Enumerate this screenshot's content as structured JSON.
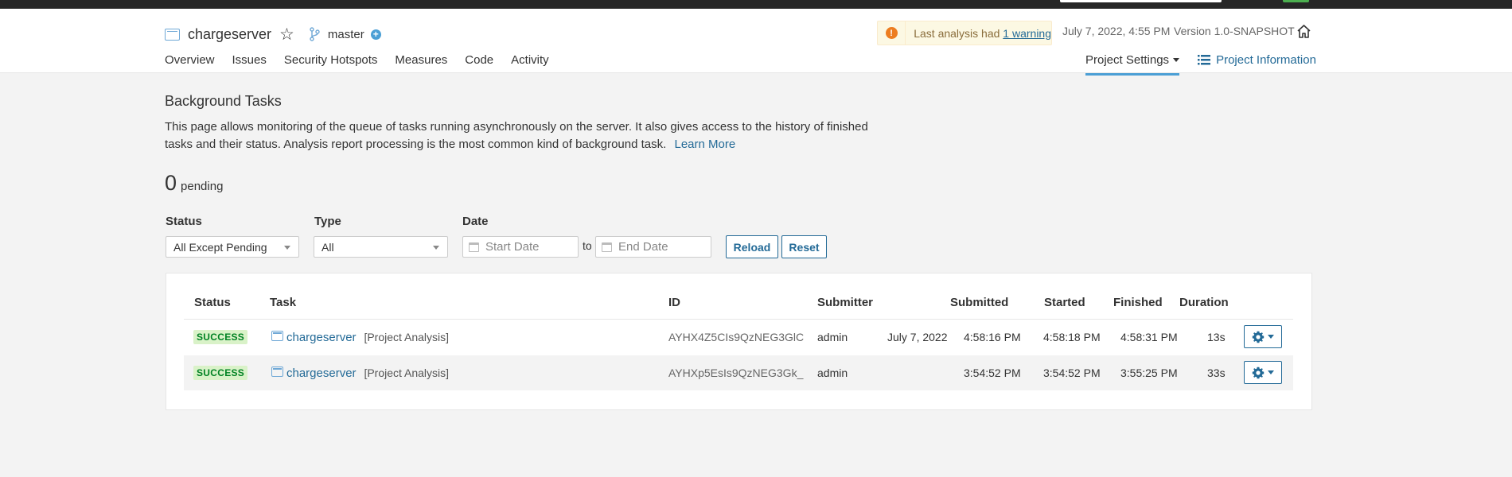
{
  "project": {
    "name": "chargeserver",
    "branch": "master"
  },
  "warning": {
    "prefix": "Last analysis had",
    "link": "1 warning"
  },
  "analysis_date": "July 7, 2022, 4:55 PM",
  "version": "Version 1.0-SNAPSHOT",
  "nav": {
    "items": [
      "Overview",
      "Issues",
      "Security Hotspots",
      "Measures",
      "Code",
      "Activity"
    ],
    "settings": "Project Settings",
    "info": "Project Information"
  },
  "page": {
    "title": "Background Tasks",
    "description": "This page allows monitoring of the queue of tasks running asynchronously on the server. It also gives access to the history of finished tasks and their status. Analysis report processing is the most common kind of background task.",
    "learn_more": "Learn More",
    "pending_count": "0",
    "pending_label": "pending"
  },
  "filters": {
    "status_label": "Status",
    "status_value": "All Except Pending",
    "type_label": "Type",
    "type_value": "All",
    "date_label": "Date",
    "start_placeholder": "Start Date",
    "to_label": "to",
    "end_placeholder": "End Date",
    "reload": "Reload",
    "reset": "Reset"
  },
  "table": {
    "headers": {
      "status": "Status",
      "task": "Task",
      "id": "ID",
      "submitter": "Submitter",
      "submitted": "Submitted",
      "started": "Started",
      "finished": "Finished",
      "duration": "Duration"
    },
    "rows": [
      {
        "status": "SUCCESS",
        "task": "chargeserver",
        "type": "[Project Analysis]",
        "id": "AYHX4Z5CIs9QzNEG3GlC",
        "submitter": "admin",
        "date": "July 7, 2022",
        "submitted": "4:58:16 PM",
        "started": "4:58:18 PM",
        "finished": "4:58:31 PM",
        "duration": "13s"
      },
      {
        "status": "SUCCESS",
        "task": "chargeserver",
        "type": "[Project Analysis]",
        "id": "AYHXp5EsIs9QzNEG3Gk_",
        "submitter": "admin",
        "date": "",
        "submitted": "3:54:52 PM",
        "started": "3:54:52 PM",
        "finished": "3:55:25 PM",
        "duration": "33s"
      }
    ]
  },
  "colors": {
    "accent": "#236a97",
    "success_bg": "#d9f2c8",
    "success_text": "#008223",
    "warning_bg": "#fcf8e3"
  }
}
